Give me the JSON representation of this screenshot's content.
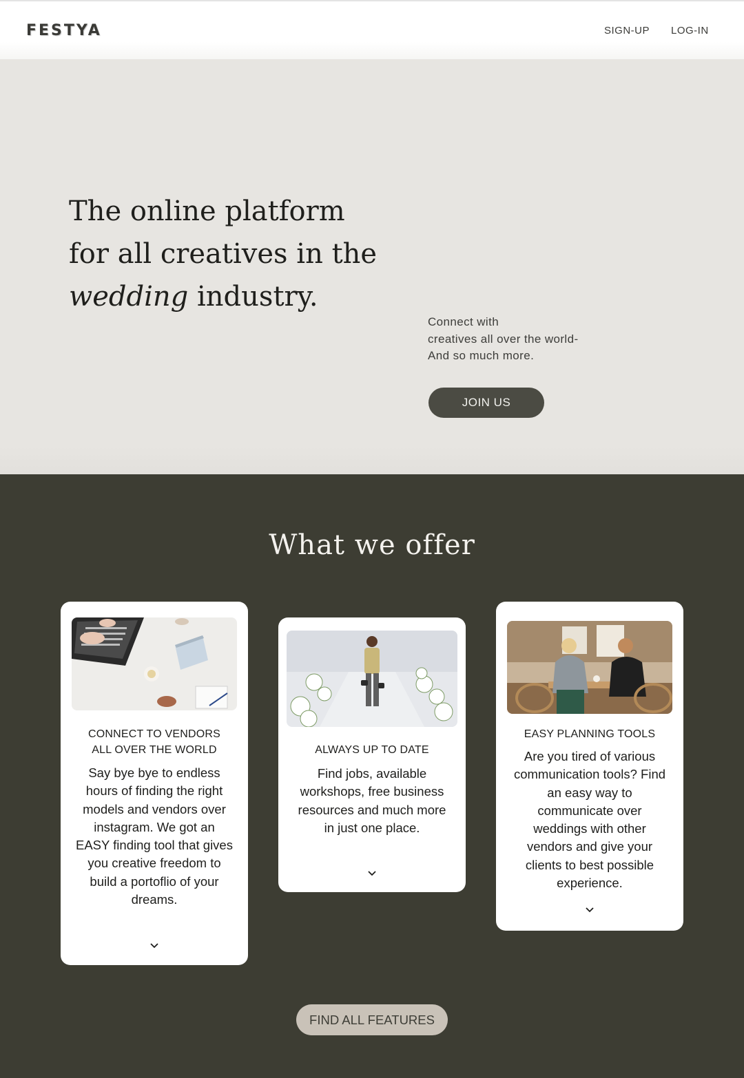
{
  "header": {
    "logo": "FESTYA",
    "nav": {
      "signup": "SIGN-UP",
      "login": "LOG-IN"
    }
  },
  "hero": {
    "headline_line1": "The online platform",
    "headline_line2": "for all creatives in the",
    "headline_italic": "wedding",
    "headline_rest": " industry.",
    "text_line1": "Connect with",
    "text_line2": "creatives all over the world-",
    "text_line3": "And so much more.",
    "cta": "JOIN US"
  },
  "offer": {
    "title": "What we offer",
    "cards": [
      {
        "title_line1": "CONNECT TO VENDORS",
        "title_line2": "ALL OVER THE WORLD",
        "body": "Say bye bye to endless hours of finding the right models and vendors over instagram. We got an EASY finding tool that gives you creative freedom to build a portoflio of your dreams.",
        "image": "laptop-desk-photo"
      },
      {
        "title_line1": "ALWAYS UP TO DATE",
        "body": "Find jobs, available workshops, free business resources and much more in just one place.",
        "image": "wedding-photographer-photo"
      },
      {
        "title_line1": "EASY PLANNING TOOLS",
        "body": "Are you tired of various communication tools? Find an easy way to communicate over weddings with other vendors and give your clients to best possible experience.",
        "image": "cafe-meeting-photo"
      }
    ],
    "cta": "FIND ALL FEATURES"
  },
  "icons": {
    "expand": "chevron-down-icon"
  },
  "colors": {
    "hero_bg": "#e7e5e1",
    "offer_bg": "#3d3d33",
    "join_button": "#4b4b43",
    "features_button": "#c9c2b8"
  }
}
